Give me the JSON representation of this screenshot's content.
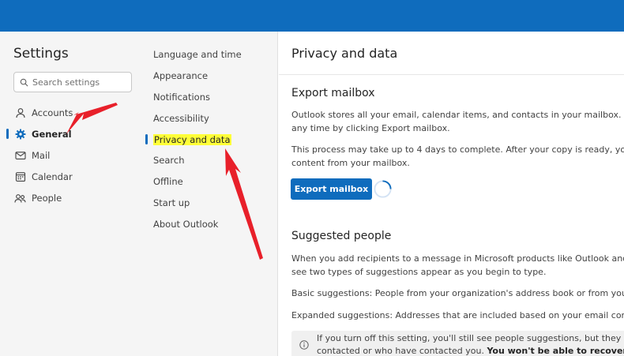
{
  "settings": {
    "title": "Settings",
    "search_placeholder": "Search settings"
  },
  "nav": {
    "items": [
      {
        "label": "Accounts",
        "icon": "person-icon"
      },
      {
        "label": "General",
        "icon": "gear-icon",
        "active": true
      },
      {
        "label": "Mail",
        "icon": "mail-icon"
      },
      {
        "label": "Calendar",
        "icon": "calendar-icon"
      },
      {
        "label": "People",
        "icon": "people-icon"
      }
    ]
  },
  "subnav": {
    "items": [
      {
        "label": "Language and time"
      },
      {
        "label": "Appearance"
      },
      {
        "label": "Notifications"
      },
      {
        "label": "Accessibility"
      },
      {
        "label": "Privacy and data",
        "active": true
      },
      {
        "label": "Search"
      },
      {
        "label": "Offline"
      },
      {
        "label": "Start up"
      },
      {
        "label": "About Outlook"
      }
    ]
  },
  "main": {
    "title": "Privacy and data",
    "export": {
      "title": "Export mailbox",
      "para1_line1": "Outlook stores all your email, calendar items, and contacts in your mailbox. You ca",
      "para1_line2": "any time by clicking Export mailbox.",
      "para2_line1": "This process may take up to 4 days to complete. After your copy is ready, you'll re",
      "para2_line2": "content from your mailbox.",
      "button": "Export mailbox"
    },
    "suggested": {
      "title": "Suggested people",
      "para1_line1": "When you add recipients to a message in Microsoft products like Outlook and Tea",
      "para1_line2": "see two types of suggestions appear as you begin to type.",
      "para2": "Basic suggestions: People from your organization's address book or from your per",
      "para3": "Expanded suggestions: Addresses that are included based on your email conversa",
      "info_line1": "If you turn off this setting, you'll still see people suggestions, but they won't",
      "info_line2_a": "contacted or who have contacted you. ",
      "info_line2_b": "You won't be able to recover this c"
    }
  },
  "colors": {
    "brand": "#0f6cbd",
    "highlight": "#ffff38",
    "arrow": "#e8202a"
  }
}
